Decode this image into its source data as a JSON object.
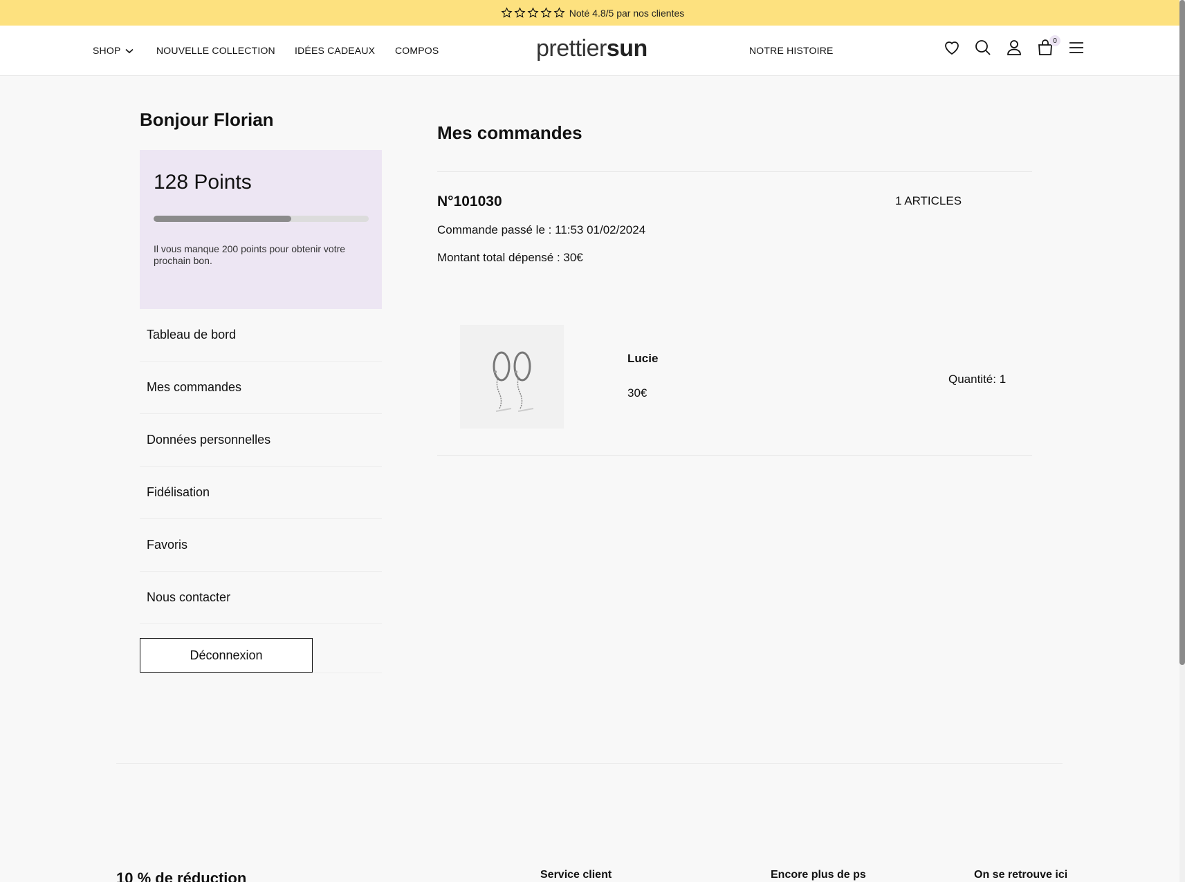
{
  "banner": {
    "rating_text": "Noté 4.8/5 par nos clientes",
    "star_icon": "star-icon",
    "star_color": "#111111",
    "background": "#fde17f"
  },
  "header": {
    "nav": [
      {
        "label": "SHOP",
        "icon": "chevron-down-icon"
      },
      {
        "label": "NOUVELLE COLLECTION"
      },
      {
        "label": "IDÉES CADEAUX"
      },
      {
        "label": "COMPOS"
      }
    ],
    "logo_light": "prettier",
    "logo_bold": "sun",
    "story_link": "NOTRE HISTOIRE",
    "icons": [
      "heart-icon",
      "search-icon",
      "user-icon",
      "bag-icon",
      "menu-icon"
    ],
    "cart_count": "0"
  },
  "account": {
    "greeting": "Bonjour Florian",
    "points": {
      "label": "128 Points",
      "progress_fraction": 0.64,
      "hint": "Il vous manque 200 points pour obtenir votre prochain bon.",
      "card_color": "#ede6f3"
    },
    "menu": [
      {
        "label": "Tableau de bord"
      },
      {
        "label": "Mes commandes"
      },
      {
        "label": "Données personnelles"
      },
      {
        "label": "Fidélisation"
      },
      {
        "label": "Favoris"
      },
      {
        "label": "Nous contacter"
      }
    ],
    "logout_label": "Déconnexion"
  },
  "orders": {
    "title": "Mes commandes",
    "items": [
      {
        "number": "N°101030",
        "count": "1 ARTICLES",
        "date": "Commande passé le : 11:53 01/02/2024",
        "total": "Montant total dépensé : 30€",
        "product": {
          "name": "Lucie",
          "price": "30€",
          "quantity": "Quantité: 1",
          "image_icon": "hoop-earrings-image"
        }
      }
    ]
  },
  "footer": {
    "promo": "10 % de réduction",
    "columns": [
      "Service client",
      "Encore plus de ps",
      "On se retrouve ici"
    ]
  }
}
